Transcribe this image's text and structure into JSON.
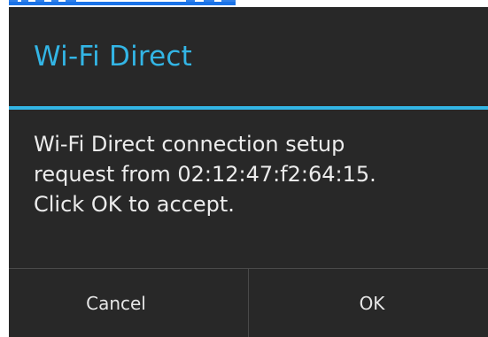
{
  "dialog": {
    "title": "Wi-Fi Direct",
    "message_lines": [
      "Wi-Fi Direct connection setup",
      "request from 02:12:47:f2:64:15.",
      "Click OK to accept."
    ],
    "buttons": {
      "cancel": "Cancel",
      "ok": "OK"
    }
  },
  "colors": {
    "dialog_background": "#282828",
    "accent": "#33b5e5",
    "text": "#ececec",
    "divider": "#4a4a4a",
    "link": "#1a73e8"
  }
}
